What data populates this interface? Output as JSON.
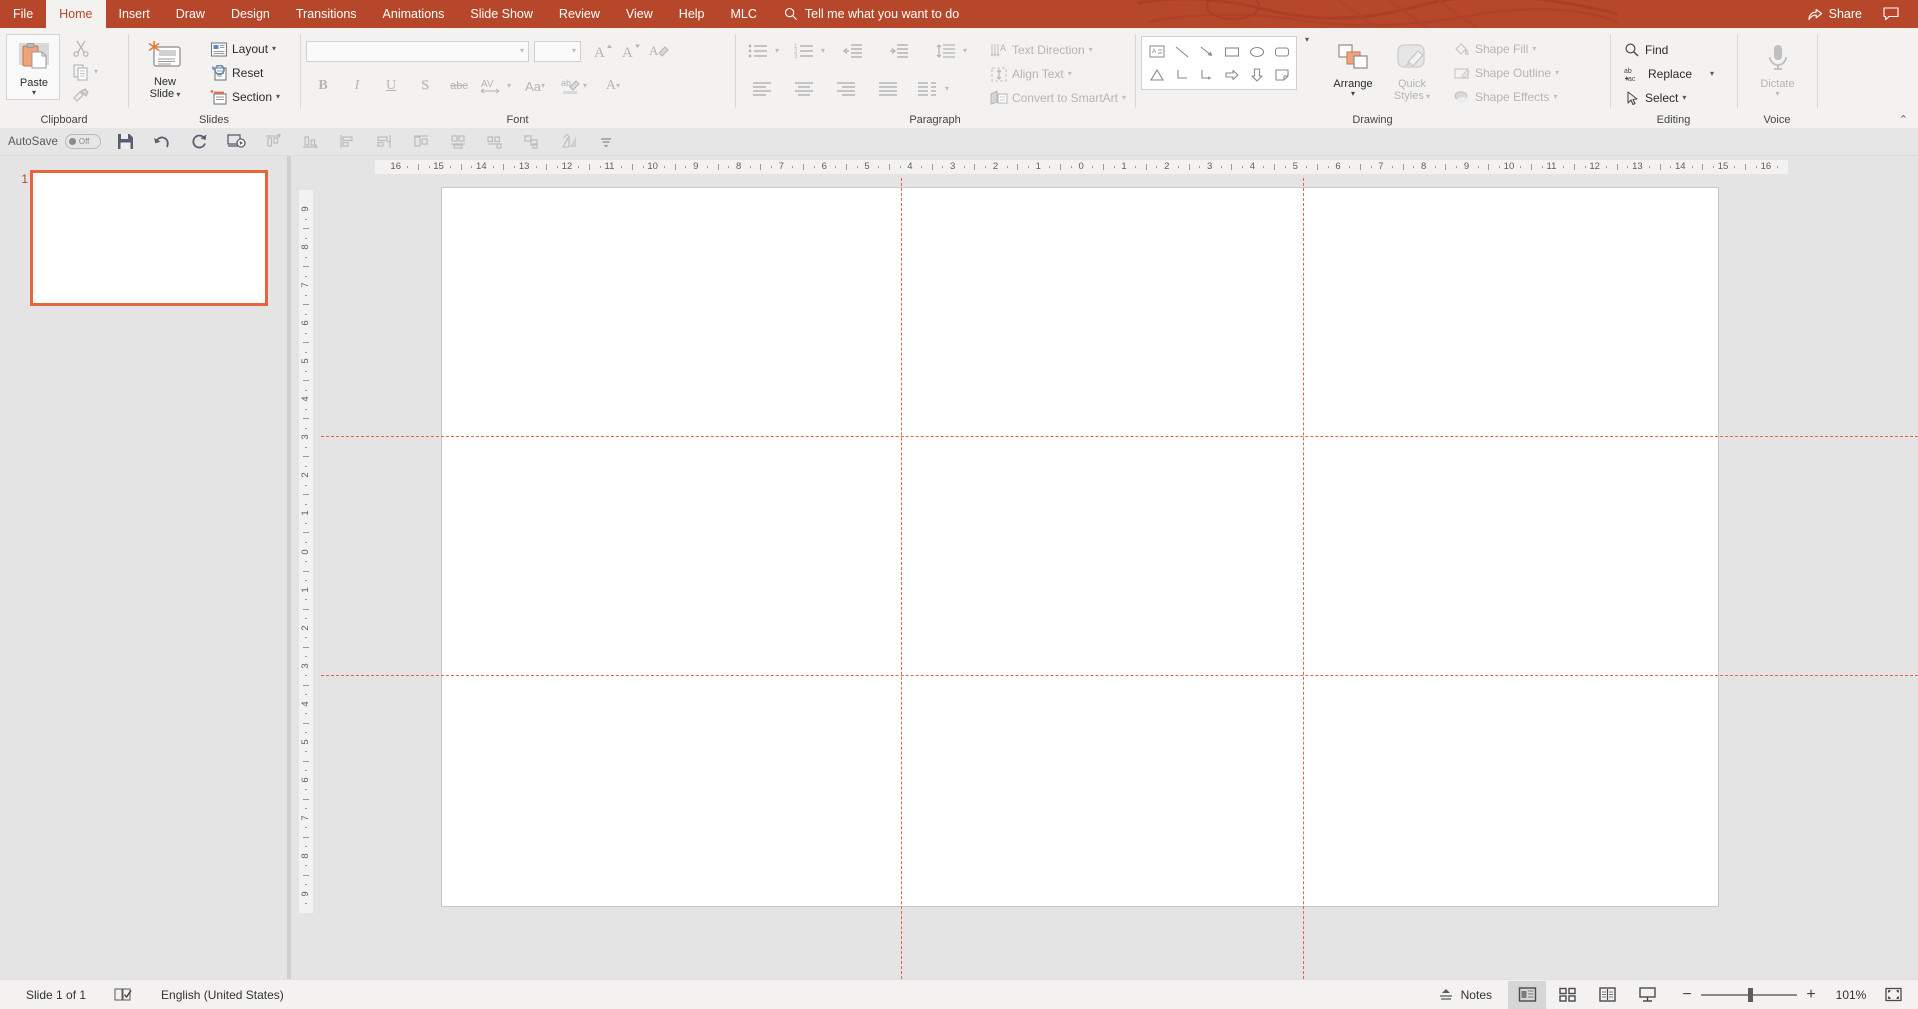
{
  "app": {
    "accent_color": "#b7472a",
    "guide_color": "#e8643c"
  },
  "titlebar": {
    "tabs": [
      {
        "label": "File",
        "active": false
      },
      {
        "label": "Home",
        "active": true
      },
      {
        "label": "Insert",
        "active": false
      },
      {
        "label": "Draw",
        "active": false
      },
      {
        "label": "Design",
        "active": false
      },
      {
        "label": "Transitions",
        "active": false
      },
      {
        "label": "Animations",
        "active": false
      },
      {
        "label": "Slide Show",
        "active": false
      },
      {
        "label": "Review",
        "active": false
      },
      {
        "label": "View",
        "active": false
      },
      {
        "label": "Help",
        "active": false
      },
      {
        "label": "MLC",
        "active": false
      }
    ],
    "tellme": "Tell me what you want to do",
    "share": "Share"
  },
  "qat": {
    "autosave_label": "AutoSave",
    "autosave_state": "Off",
    "buttons": [
      "save-icon",
      "undo-icon",
      "redo-icon",
      "start-from-beginning-icon",
      "align-top-icon",
      "align-bottom-icon",
      "align-left-icon",
      "distribute-right-icon",
      "align-center-icon",
      "align-middle-icon",
      "distribute-horizontal-icon",
      "group-icon",
      "selection-pane-icon",
      "rotate-icon",
      "customize-qat-icon"
    ]
  },
  "ribbon": {
    "groups": [
      {
        "name": "Clipboard",
        "label": "Clipboard",
        "paste": {
          "label_line1": "Paste",
          "icon": "paste-icon"
        },
        "items": [
          {
            "label": "",
            "icon": "cut-icon",
            "disabled": true
          },
          {
            "label": "",
            "icon": "copy-icon",
            "disabled": true
          },
          {
            "label": "",
            "icon": "format-painter-icon",
            "disabled": true
          }
        ]
      },
      {
        "name": "Slides",
        "label": "Slides",
        "new_slide": {
          "line1": "New",
          "line2": "Slide"
        },
        "items": [
          {
            "label": "Layout",
            "icon": "layout-icon",
            "caret": true
          },
          {
            "label": "Reset",
            "icon": "reset-icon",
            "caret": false
          },
          {
            "label": "Section",
            "icon": "section-icon",
            "caret": true
          }
        ]
      },
      {
        "name": "Font",
        "label": "Font",
        "font_name_value": "",
        "font_size_value": "",
        "buttons": [
          "increase-font-size-icon",
          "decrease-font-size-icon",
          "clear-formatting-icon",
          "bold-icon",
          "italic-icon",
          "underline-icon",
          "text-shadow-icon",
          "strikethrough-icon",
          "character-spacing-icon",
          "change-case-icon",
          "text-highlight-color-icon",
          "font-color-icon"
        ]
      },
      {
        "name": "Paragraph",
        "label": "Paragraph",
        "items": [
          {
            "label": "Text Direction",
            "icon": "text-direction-icon"
          },
          {
            "label": "Align Text",
            "icon": "align-text-icon"
          },
          {
            "label": "Convert to SmartArt",
            "icon": "convert-smartart-icon"
          }
        ]
      },
      {
        "name": "Drawing",
        "label": "Drawing",
        "arrange": "Arrange",
        "quick_styles_line1": "Quick",
        "quick_styles_line2": "Styles",
        "items": [
          {
            "label": "Shape Fill",
            "icon": "shape-fill-icon"
          },
          {
            "label": "Shape Outline",
            "icon": "shape-outline-icon"
          },
          {
            "label": "Shape Effects",
            "icon": "shape-effects-icon"
          }
        ],
        "shapes": [
          "text-box-shape",
          "line-shape",
          "arrow-shape",
          "rectangle-shape",
          "oval-shape",
          "rounded-rectangle-shape",
          "triangle-shape",
          "elbow-connector-shape",
          "elbow-arrow-connector-shape",
          "right-arrow-shape",
          "down-arrow-shape",
          "folded-corner-shape"
        ]
      },
      {
        "name": "Editing",
        "label": "Editing",
        "items": [
          {
            "label": "Find",
            "icon": "find-icon",
            "caret": false
          },
          {
            "label": "Replace",
            "icon": "replace-icon",
            "caret": true
          },
          {
            "label": "Select",
            "icon": "select-icon",
            "caret": true
          }
        ]
      },
      {
        "name": "Voice",
        "label": "Voice",
        "dictate": "Dictate"
      }
    ]
  },
  "thumbnails": {
    "slides": [
      {
        "number": "1"
      }
    ]
  },
  "rulers": {
    "horizontal_ticks": [
      "16",
      "15",
      "14",
      "13",
      "12",
      "11",
      "10",
      "9",
      "8",
      "7",
      "6",
      "5",
      "4",
      "3",
      "2",
      "1",
      "0",
      "1",
      "2",
      "3",
      "4",
      "5",
      "6",
      "7",
      "8",
      "9",
      "10",
      "11",
      "12",
      "13",
      "14",
      "15",
      "16"
    ],
    "vertical_ticks": [
      "9",
      "8",
      "7",
      "6",
      "5",
      "4",
      "3",
      "2",
      "1",
      "0",
      "1",
      "2",
      "3",
      "4",
      "5",
      "6",
      "7",
      "8",
      "9"
    ]
  },
  "status": {
    "slide_count": "Slide 1 of 1",
    "accessibility_icon": "accessibility-checker-icon",
    "language": "English (United States)",
    "notes": "Notes",
    "views": [
      {
        "name": "normal-view",
        "active": true
      },
      {
        "name": "slide-sorter-view",
        "active": false
      },
      {
        "name": "reading-view",
        "active": false
      },
      {
        "name": "slide-show-view",
        "active": false
      }
    ],
    "zoom_out": "−",
    "zoom_in": "+",
    "zoom_value": "101%",
    "fit_to_window": "fit-slide-to-window-icon"
  }
}
